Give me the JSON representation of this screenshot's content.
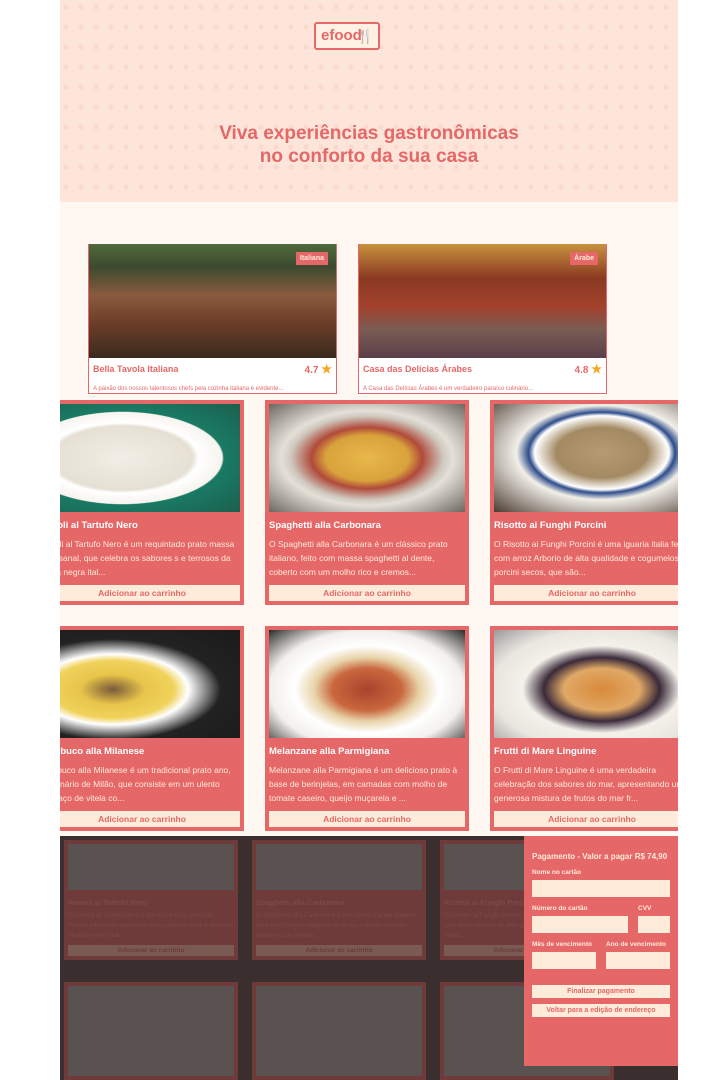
{
  "brand": {
    "logo_text": "efood",
    "logo_icon": "fork-knife-icon"
  },
  "hero": {
    "title_line1": "Viva experiências gastronômicas",
    "title_line2": "no conforto da sua casa"
  },
  "restaurants": [
    {
      "name": "Bella Tavola Italiana",
      "tag": "Italiana",
      "rating": "4.7",
      "description": "A paixão dos nossos talentosos chefs pela cozinha italiana é evidente..."
    },
    {
      "name": "Casa das Delícias Árabes",
      "tag": "Árabe",
      "rating": "4.8",
      "description": "A Casa das Delícias Árabes é um verdadeiro paraíso culinário..."
    }
  ],
  "dishes": [
    {
      "title": "Ravioli al Tartufo Nero",
      "title_visible": "avioli al Tartufo Nero",
      "description": "avioli al Tartufo Nero é um requintado prato massa artesanal, que celebra os sabores s e terrosos da trufa negra ital...",
      "button": "Adicionar ao carrinho"
    },
    {
      "title": "Spaghetti alla Carbonara",
      "description": "O Spaghetti alla Carbonara é um clássico prato italiano, feito com massa spaghetti al dente, coberto com um molho rico e cremos...",
      "button": "Adicionar ao carrinho"
    },
    {
      "title": "Risotto ai Funghi Porcini",
      "description": "O Risotto ai Funghi Porcini é uma iguaria italia feita com arroz Arborio de alta qualidade e cogumelos porcini secos, que são...",
      "button": "Adicionar ao carrinho"
    },
    {
      "title": "ssobuco alla Milanese",
      "description": "ssobuco alla Milanese é um tradicional prato ano, originário de Milão, que consiste em um ulento pedaço de vitela co...",
      "button": "Adicionar ao carrinho"
    },
    {
      "title": "Melanzane alla Parmigiana",
      "description": "Melanzane alla Parmigiana é um delicioso prato à base de berinjelas, em camadas com molho de tomate caseiro, queijo muçarela e ...",
      "button": "Adicionar ao carrinho"
    },
    {
      "title": "Frutti di Mare Linguine",
      "description": "O Frutti di Mare Linguine é uma verdadeira celebração dos sabores do mar, apresentando uma generosa mistura de frutos do mar fr...",
      "button": "Adicionar ao carrinho"
    }
  ],
  "background_dishes": [
    {
      "title": "Ravioli al Tartufo Nero",
      "description": "O Ravioli al Tartufo Nero é um requintado prato de massa artesanal, que celebra os sabores ricos e terrosos da trufa negra ital...",
      "button": "Adicionar ao carrinho"
    },
    {
      "title": "Spaghetti alla Carbonara",
      "description": "O Spaghetti alla Carbonara é um clássico prato italiano, feito com massa spaghetti al dente, coberto com um molho rico e cremos...",
      "button": "Adicionar ao carrinho"
    },
    {
      "title": "Risotto ai Funghi Porcini",
      "description": "O Risotto ai Funghi Porcini é uma iguaria italiana feita com arroz Arborio de alta qualidade e cogumelos porcini secos...",
      "button": "Adicionar ao carrinho"
    }
  ],
  "payment": {
    "title": "Pagamento - Valor a pagar R$ 74,90",
    "card_name_label": "Nome no cartão",
    "card_number_label": "Número do cartão",
    "cvv_label": "CVV",
    "exp_month_label": "Mês de vencimento",
    "exp_year_label": "Ano de vencimento",
    "submit": "Finalizar pagamento",
    "back": "Voltar para a edição de endereço"
  }
}
